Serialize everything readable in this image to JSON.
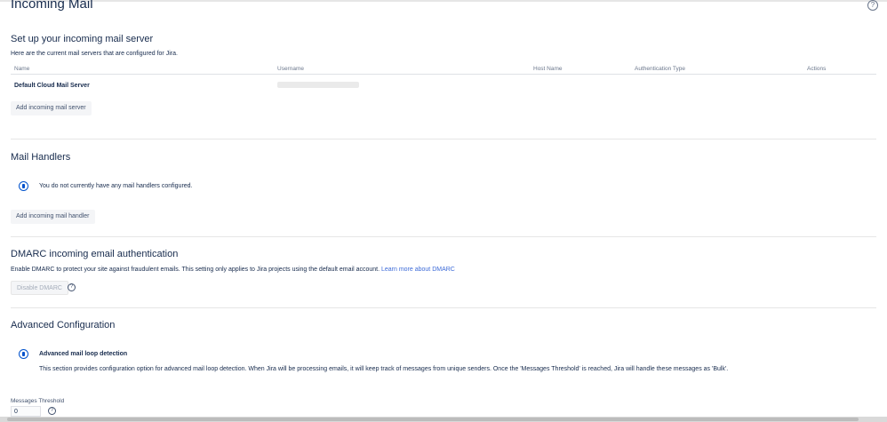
{
  "page": {
    "title": "Incoming Mail",
    "help_icon": "question-circle-icon"
  },
  "mail_server": {
    "heading": "Set up your incoming mail server",
    "description": "Here are the current mail servers that are configured for Jira.",
    "columns": [
      "Name",
      "Username",
      "Host Name",
      "Authentication Type",
      "Actions"
    ],
    "rows": [
      {
        "name": "Default Cloud Mail Server",
        "username": "",
        "host_name": "",
        "auth_type": "",
        "actions": ""
      }
    ],
    "add_button": "Add incoming mail server"
  },
  "mail_handlers": {
    "heading": "Mail Handlers",
    "info_icon": "info-icon",
    "message": "You do not currently have any mail handlers configured.",
    "add_button": "Add incoming mail handler"
  },
  "dmarc": {
    "heading": "DMARC incoming email authentication",
    "description": "Enable DMARC to protect your site against fraudulent emails. This setting only applies to Jira projects using the default email account.",
    "link_text": "Learn more about DMARC",
    "button": "Disable DMARC",
    "help_icon": "question-circle-icon"
  },
  "advanced": {
    "heading": "Advanced Configuration",
    "info_icon": "info-icon",
    "title": "Advanced mail loop detection",
    "description": "This section provides configuration option for advanced mail loop detection. When Jira will be processing emails, it will keep track of messages from unique senders. Once the 'Messages Threshold' is reached, Jira will handle these messages as 'Bulk'.",
    "threshold_label": "Messages Threshold",
    "threshold_value": "0",
    "help_icon": "question-circle-icon"
  },
  "colors": {
    "text": "#172b4d",
    "link": "#3d6bd8",
    "info": "#0052cc",
    "button_bg": "#f4f5f7"
  }
}
